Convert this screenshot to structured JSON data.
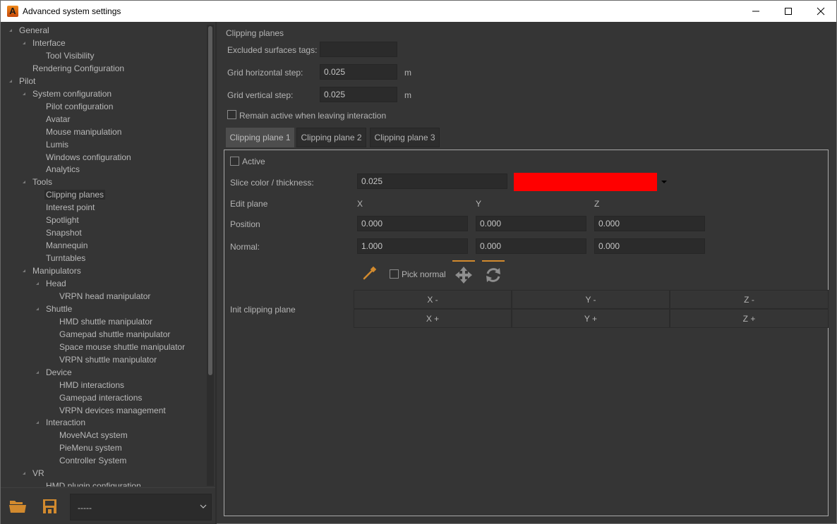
{
  "window": {
    "title": "Advanced system settings",
    "app_icon": "A",
    "controls": {
      "minimize": "minimize-icon",
      "maximize": "maximize-icon",
      "close": "close-icon"
    }
  },
  "sidebar": {
    "tree": [
      {
        "label": "General",
        "level": 0,
        "expanded": true
      },
      {
        "label": "Interface",
        "level": 1,
        "expanded": true
      },
      {
        "label": "Tool Visibility",
        "level": 2
      },
      {
        "label": "Rendering Configuration",
        "level": 1
      },
      {
        "label": "Pilot",
        "level": 0,
        "expanded": true
      },
      {
        "label": "System configuration",
        "level": 1,
        "expanded": true
      },
      {
        "label": "Pilot configuration",
        "level": 2
      },
      {
        "label": "Avatar",
        "level": 2
      },
      {
        "label": "Mouse manipulation",
        "level": 2
      },
      {
        "label": "Lumis",
        "level": 2
      },
      {
        "label": "Windows configuration",
        "level": 2
      },
      {
        "label": "Analytics",
        "level": 2
      },
      {
        "label": "Tools",
        "level": 1,
        "expanded": true
      },
      {
        "label": "Clipping planes",
        "level": 2,
        "selected": true
      },
      {
        "label": "Interest point",
        "level": 2
      },
      {
        "label": "Spotlight",
        "level": 2
      },
      {
        "label": "Snapshot",
        "level": 2
      },
      {
        "label": "Mannequin",
        "level": 2
      },
      {
        "label": "Turntables",
        "level": 2
      },
      {
        "label": "Manipulators",
        "level": 1,
        "expanded": true
      },
      {
        "label": "Head",
        "level": 2,
        "expanded": true
      },
      {
        "label": "VRPN head manipulator",
        "level": 3
      },
      {
        "label": "Shuttle",
        "level": 2,
        "expanded": true
      },
      {
        "label": "HMD shuttle manipulator",
        "level": 3
      },
      {
        "label": "Gamepad shuttle manipulator",
        "level": 3
      },
      {
        "label": "Space mouse shuttle manipulator",
        "level": 3
      },
      {
        "label": "VRPN shuttle manipulator",
        "level": 3
      },
      {
        "label": "Device",
        "level": 2,
        "expanded": true
      },
      {
        "label": "HMD interactions",
        "level": 3
      },
      {
        "label": "Gamepad interactions",
        "level": 3
      },
      {
        "label": "VRPN devices management",
        "level": 3
      },
      {
        "label": "Interaction",
        "level": 2,
        "expanded": true
      },
      {
        "label": "MoveNAct system",
        "level": 3
      },
      {
        "label": "PieMenu system",
        "level": 3
      },
      {
        "label": "Controller System",
        "level": 3
      },
      {
        "label": "VR",
        "level": 1,
        "expanded": true
      },
      {
        "label": "HMD plugin configuration",
        "level": 2
      }
    ],
    "bottom": {
      "open_icon": "folder-open-icon",
      "save_icon": "floppy-save-icon",
      "preset_value": "-----"
    }
  },
  "main": {
    "section_title": "Clipping planes",
    "excluded_tags": {
      "label": "Excluded surfaces tags:",
      "value": ""
    },
    "grid_h": {
      "label": "Grid horizontal step:",
      "value": "0.025",
      "unit": "m"
    },
    "grid_v": {
      "label": "Grid vertical step:",
      "value": "0.025",
      "unit": "m"
    },
    "remain_active": {
      "label": "Remain active when leaving interaction",
      "checked": false
    },
    "tabs": [
      {
        "label": "Clipping plane 1",
        "active": true
      },
      {
        "label": "Clipping plane 2",
        "active": false
      },
      {
        "label": "Clipping plane 3",
        "active": false
      }
    ],
    "panel": {
      "active": {
        "label": "Active",
        "checked": false
      },
      "slice": {
        "label": "Slice color / thickness:",
        "thickness": "0.025",
        "color": "#ff0000"
      },
      "edit_plane": {
        "label": "Edit plane",
        "x": "X",
        "y": "Y",
        "z": "Z"
      },
      "position": {
        "label": "Position",
        "x": "0.000",
        "y": "0.000",
        "z": "0.000"
      },
      "normal": {
        "label": "Normal:",
        "x": "1.000",
        "y": "0.000",
        "z": "0.000"
      },
      "pick_normal": {
        "label": "Pick normal",
        "checked": false
      },
      "init": {
        "label": "Init clipping plane",
        "buttons": [
          [
            "X -",
            "Y -",
            "Z -"
          ],
          [
            "X +",
            "Y +",
            "Z +"
          ]
        ]
      }
    }
  },
  "colors": {
    "accent": "#d28a2e",
    "background": "#353535",
    "field": "#2b2b2b",
    "slice": "#ff0000"
  }
}
